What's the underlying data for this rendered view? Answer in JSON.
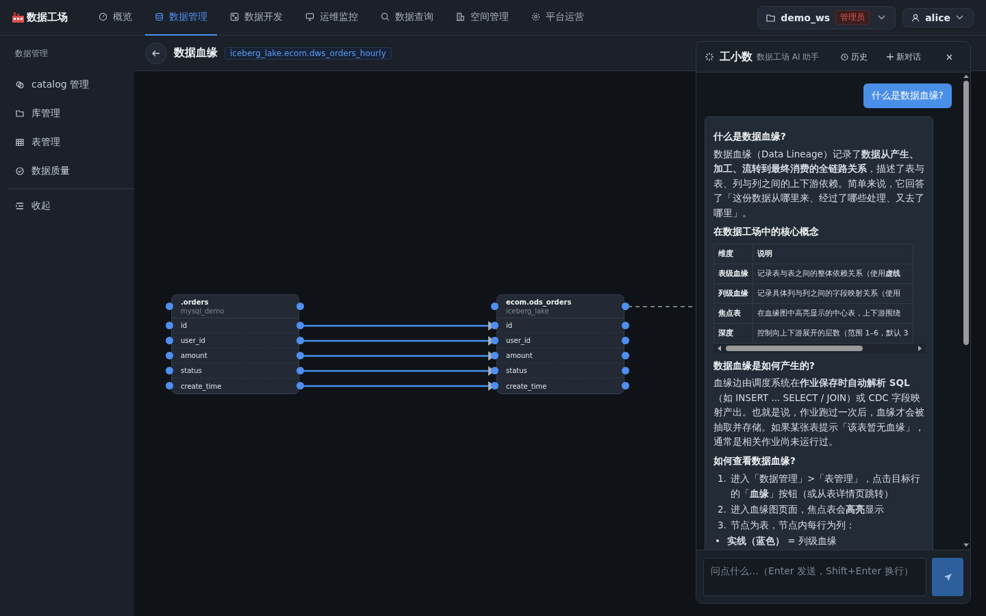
{
  "app": {
    "name": "数据工场"
  },
  "nav_tabs": [
    {
      "label": "概览",
      "selected": false
    },
    {
      "label": "数据管理",
      "selected": true
    },
    {
      "label": "数据开发",
      "selected": false
    },
    {
      "label": "运维监控",
      "selected": false
    },
    {
      "label": "数据查询",
      "selected": false
    },
    {
      "label": "空间管理",
      "selected": false
    },
    {
      "label": "平台运营",
      "selected": false
    }
  ],
  "workspace": {
    "name": "demo_ws",
    "role": "管理员"
  },
  "user": {
    "name": "alice"
  },
  "sidebar": {
    "title": "数据管理",
    "items": [
      {
        "label": "catalog 管理"
      },
      {
        "label": "库管理"
      },
      {
        "label": "表管理"
      },
      {
        "label": "数据质量"
      }
    ],
    "collapse": "收起"
  },
  "page": {
    "title": "数据血缘",
    "table_tag": "iceberg_lake.ecom.dws_orders_hourly"
  },
  "lineage": {
    "nodes": [
      {
        "name": ".orders",
        "source": "mysql_demo",
        "columns": [
          "id",
          "user_id",
          "amount",
          "status",
          "create_time"
        ]
      },
      {
        "name": "ecom.ods_orders",
        "source": "iceberg_lake",
        "columns": [
          "id",
          "user_id",
          "amount",
          "status",
          "create_time"
        ]
      }
    ]
  },
  "assistant": {
    "name": "工小数",
    "subtitle": "数据工场 AI 助手",
    "history": "历史",
    "new_chat": "新对话",
    "messages": [
      {
        "kind": "question",
        "text": "什么是数据血缘?"
      },
      {
        "kind": "answer",
        "blocks": [
          {
            "kind": "heading",
            "text": "什么是数据血缘?"
          },
          {
            "kind": "paragraph",
            "text": "数据血缘（Data Lineage）记录了**数据从产生、加工、流转到最终消费的全链路关系**，描述了表与表、列与列之间的上下游依赖。简单来说，它回答了「这份数据从哪里来、经过了哪些处理、又去了哪里」。"
          },
          {
            "kind": "heading",
            "text": "在数据工场中的核心概念"
          },
          {
            "kind": "table",
            "columns": [
              "维度",
              "说明"
            ],
            "rows": [
              [
                "表级血缘",
                "记录表与表之间的整体依赖关系（使用**虚线**"
              ],
              [
                "列级血缘",
                "记录具体列与列之间的字段映射关系（使用"
              ],
              [
                "焦点表",
                "在血缘图中高亮显示的中心表，上下游围绕"
              ],
              [
                "深度",
                "控制向上下游展开的层数（范围 1–6，默认 3"
              ]
            ]
          },
          {
            "kind": "heading",
            "text": "数据血缘是如何产生的?"
          },
          {
            "kind": "paragraph",
            "text": "血缘边由调度系统在**作业保存时自动解析 SQL**（如 INSERT ... SELECT / JOIN）或 CDC 字段映射产出。也就是说，作业跑过一次后，血缘才会被抽取并存储。如果某张表提示「该表暂无血缘」，通常是相关作业尚未运行过。"
          },
          {
            "kind": "heading",
            "text": "如何查看数据血缘?"
          },
          {
            "kind": "list",
            "items": [
              {
                "marker": "1.",
                "text": "进入「数据管理」>「表管理」，点击目标行的「**血缘**」按钮（或从表详情页跳转）"
              },
              {
                "marker": "2.",
                "text": "进入血缘图页面，焦点表会**高亮**显示"
              },
              {
                "marker": "3.",
                "text": "节点为表，节点内每行为列："
              },
              {
                "marker": "•",
                "text": "**实线（蓝色）** = 列级血缘"
              }
            ]
          }
        ]
      }
    ],
    "input": {
      "placeholder": "问点什么…（Enter 发送，Shift+Enter 换行）"
    }
  }
}
